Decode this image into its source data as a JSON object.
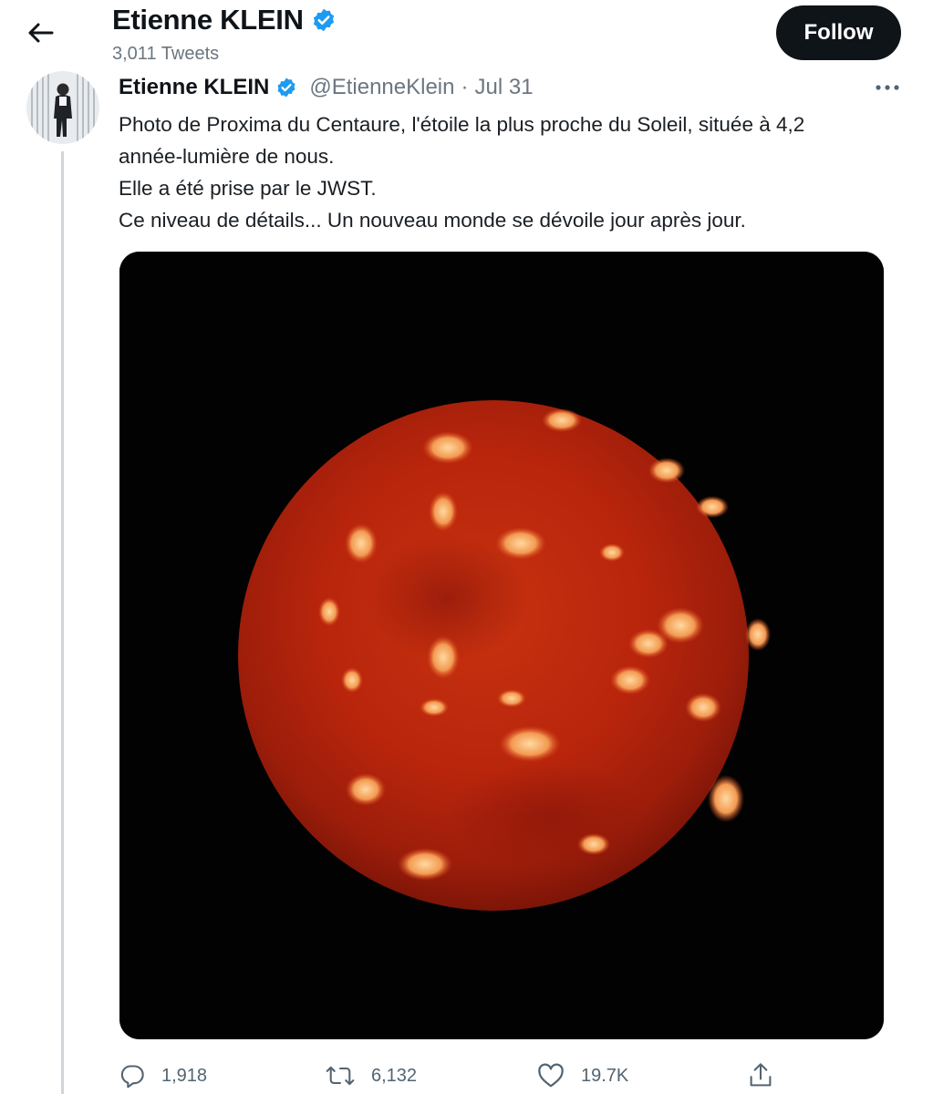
{
  "header": {
    "back_icon": "arrow-left-icon",
    "display_name": "Etienne KLEIN",
    "verified_icon": "verified-badge-icon",
    "tweet_count": "3,011 Tweets",
    "follow_label": "Follow"
  },
  "tweet": {
    "display_name": "Etienne KLEIN",
    "handle": "@EtienneKlein",
    "separator": "·",
    "date": "Jul 31",
    "more_icon": "more-horizontal-icon",
    "text_lines": [
      "Photo de Proxima du Centaure, l'étoile la plus proche du Soleil, située à 4,2",
      "année-lumière de nous.",
      "Elle a été prise par le JWST.",
      "Ce niveau de détails... Un nouveau monde se dévoile jour après jour."
    ],
    "media_icon": "red-sphere-photo"
  },
  "actions": {
    "reply": {
      "icon": "reply-icon",
      "count": "1,918"
    },
    "retweet": {
      "icon": "retweet-icon",
      "count": "6,132"
    },
    "like": {
      "icon": "heart-icon",
      "count": "19.7K"
    },
    "share": {
      "icon": "share-icon"
    }
  },
  "colors": {
    "verified": "#1d9bf0",
    "follow_bg": "#0f1419",
    "secondary_text": "#6b7680",
    "media_bg": "#020202",
    "sphere": "#b8250c"
  }
}
